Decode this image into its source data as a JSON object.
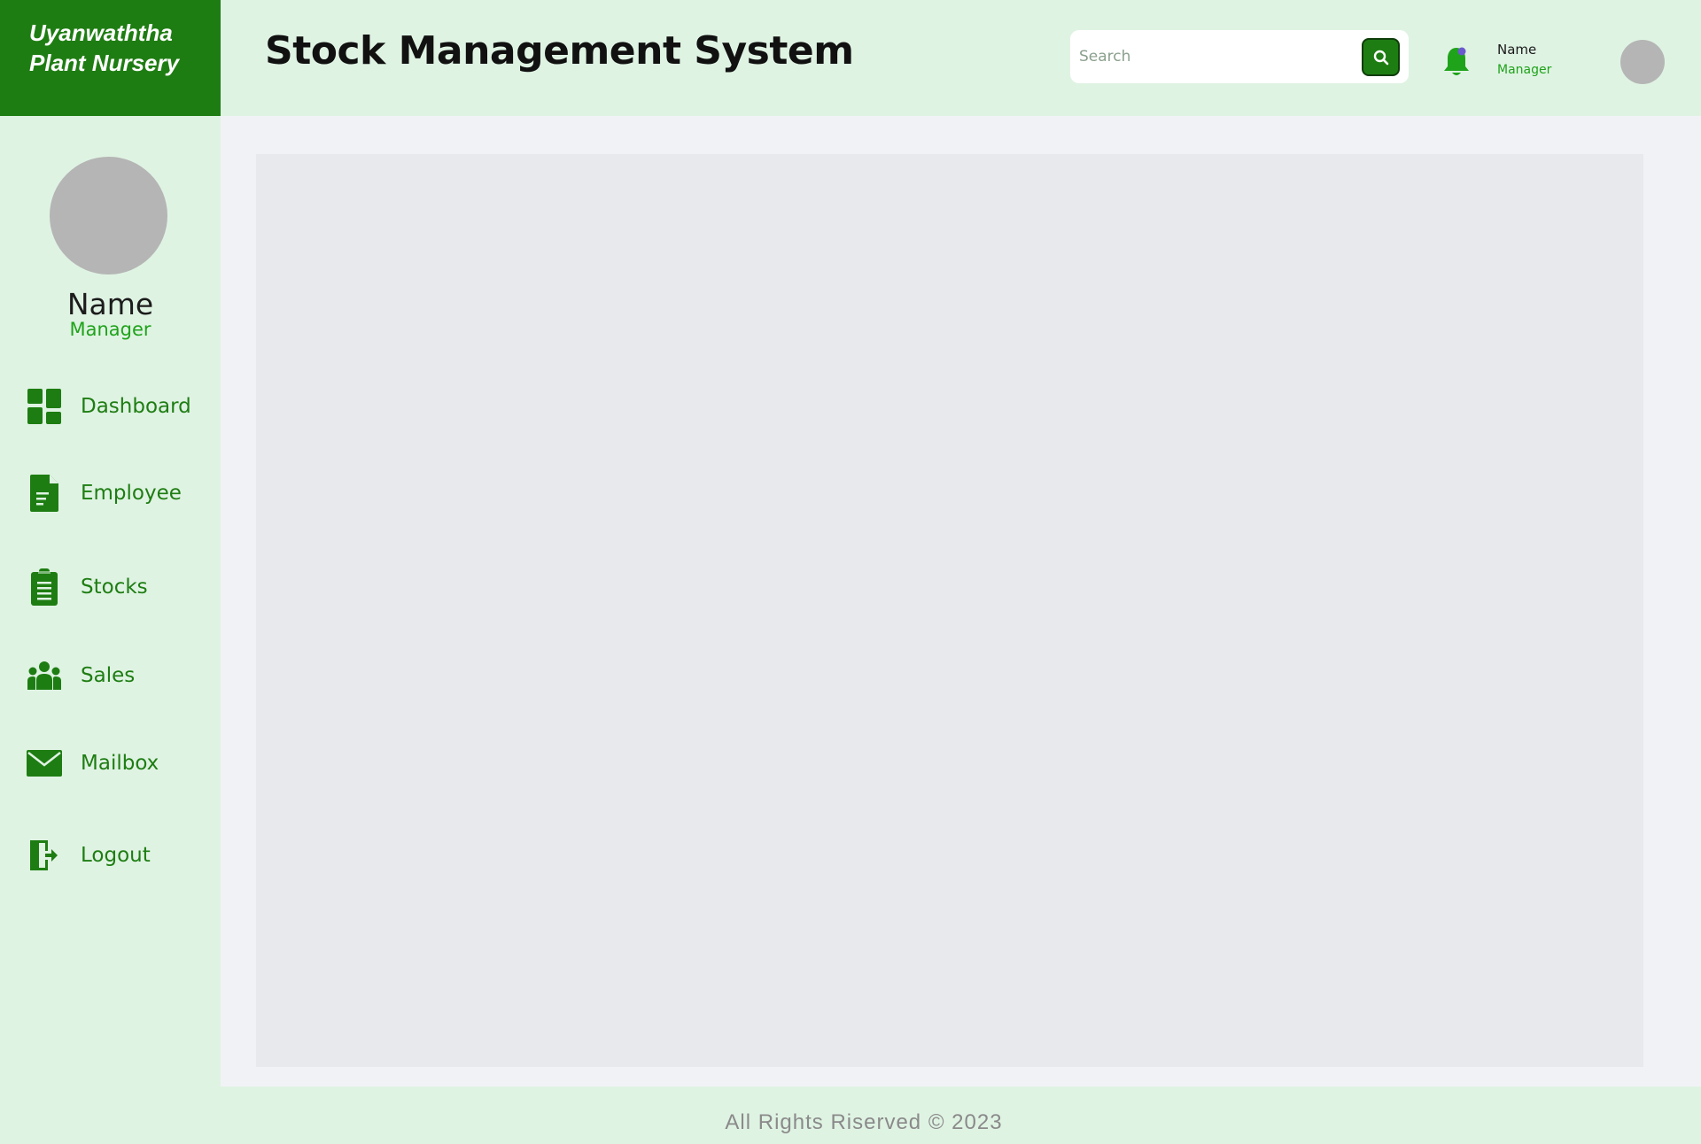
{
  "brand": {
    "line1": "Uyanwaththa",
    "line2": "Plant Nursery",
    "color": "#1e7d12"
  },
  "header": {
    "title": "Stock Management System",
    "search": {
      "placeholder": "Search",
      "value": "",
      "icon": "search-icon"
    },
    "notification_icon": "bell-icon",
    "user": {
      "name": "Name",
      "role": "Manager"
    }
  },
  "sidebar": {
    "profile": {
      "name": "Name",
      "role": "Manager"
    },
    "items": [
      {
        "label": "Dashboard",
        "icon": "dashboard-icon"
      },
      {
        "label": "Employee",
        "icon": "document-icon"
      },
      {
        "label": "Stocks",
        "icon": "clipboard-icon"
      },
      {
        "label": "Sales",
        "icon": "users-icon"
      },
      {
        "label": "Mailbox",
        "icon": "envelope-icon"
      },
      {
        "label": "Logout",
        "icon": "logout-icon"
      }
    ]
  },
  "footer": {
    "text": "All Rights Riserved ©  2023"
  },
  "colors": {
    "accent": "#1e7d12",
    "accent_light": "#1fa31a",
    "panel_bg": "#dff3e3",
    "content_bg": "#e8e9ed",
    "notification_dot": "#6a5acd"
  }
}
